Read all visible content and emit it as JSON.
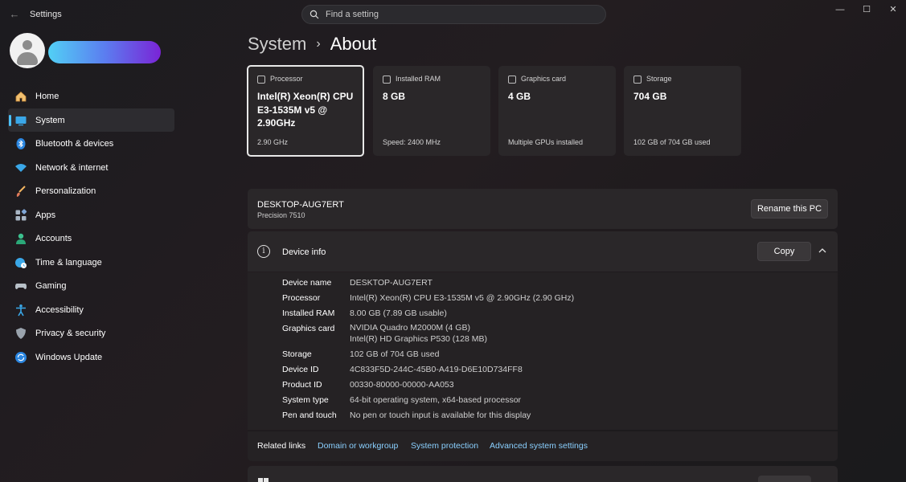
{
  "window": {
    "title": "Settings",
    "back_glyph": "←",
    "minimize_glyph": "—",
    "maximize_glyph": "☐",
    "close_glyph": "✕"
  },
  "search": {
    "placeholder": "Find a setting"
  },
  "sidebar": {
    "items": [
      {
        "label": "Home",
        "icon": "home-icon"
      },
      {
        "label": "System",
        "icon": "system-icon",
        "active": true
      },
      {
        "label": "Bluetooth & devices",
        "icon": "bluetooth-icon"
      },
      {
        "label": "Network & internet",
        "icon": "wifi-icon"
      },
      {
        "label": "Personalization",
        "icon": "brush-icon"
      },
      {
        "label": "Apps",
        "icon": "apps-icon"
      },
      {
        "label": "Accounts",
        "icon": "account-icon"
      },
      {
        "label": "Time & language",
        "icon": "globe-clock-icon"
      },
      {
        "label": "Gaming",
        "icon": "gamepad-icon"
      },
      {
        "label": "Accessibility",
        "icon": "accessibility-icon"
      },
      {
        "label": "Privacy & security",
        "icon": "shield-icon"
      },
      {
        "label": "Windows Update",
        "icon": "update-icon"
      }
    ]
  },
  "breadcrumb": {
    "parent": "System",
    "separator": "›",
    "current": "About"
  },
  "cards": [
    {
      "label": "Processor",
      "value": "Intel(R) Xeon(R) CPU E3-1535M v5 @ 2.90GHz",
      "sub": "2.90 GHz",
      "icon": "processor-icon"
    },
    {
      "label": "Installed RAM",
      "value": "8 GB",
      "sub": "Speed: 2400 MHz",
      "icon": "ram-icon"
    },
    {
      "label": "Graphics card",
      "value": "4 GB",
      "sub": "Multiple GPUs installed",
      "icon": "graphics-card-icon"
    },
    {
      "label": "Storage",
      "value": "704 GB",
      "sub": "102 GB of 704 GB used",
      "icon": "storage-icon"
    }
  ],
  "pc": {
    "name": "DESKTOP-AUG7ERT",
    "model": "Precision 7510",
    "rename_label": "Rename this PC"
  },
  "device_info": {
    "title": "Device info",
    "copy_label": "Copy",
    "specs": [
      {
        "label": "Device name",
        "value": "DESKTOP-AUG7ERT"
      },
      {
        "label": "Processor",
        "value": "Intel(R) Xeon(R) CPU E3-1535M v5 @ 2.90GHz (2.90 GHz)"
      },
      {
        "label": "Installed RAM",
        "value": "8.00 GB (7.89 GB usable)"
      },
      {
        "label": "Graphics card",
        "value": "NVIDIA Quadro M2000M (4 GB)",
        "value2": "Intel(R) HD Graphics P530 (128 MB)"
      },
      {
        "label": "Storage",
        "value": "102 GB of 704 GB used"
      },
      {
        "label": "Device ID",
        "value": "4C833F5D-244C-45B0-A419-D6E10D734FF8"
      },
      {
        "label": "Product ID",
        "value": "00330-80000-00000-AA053"
      },
      {
        "label": "System type",
        "value": "64-bit operating system, x64-based processor"
      },
      {
        "label": "Pen and touch",
        "value": "No pen or touch input is available for this display"
      }
    ]
  },
  "related": {
    "label": "Related links",
    "links": [
      "Domain or workgroup",
      "System protection",
      "Advanced system settings"
    ]
  },
  "colors": {
    "accent": "#4cc2ff",
    "link": "#8ad0ff",
    "user_gradient": [
      "#52d0f5",
      "#5b7ef0",
      "#7a24d6"
    ]
  }
}
